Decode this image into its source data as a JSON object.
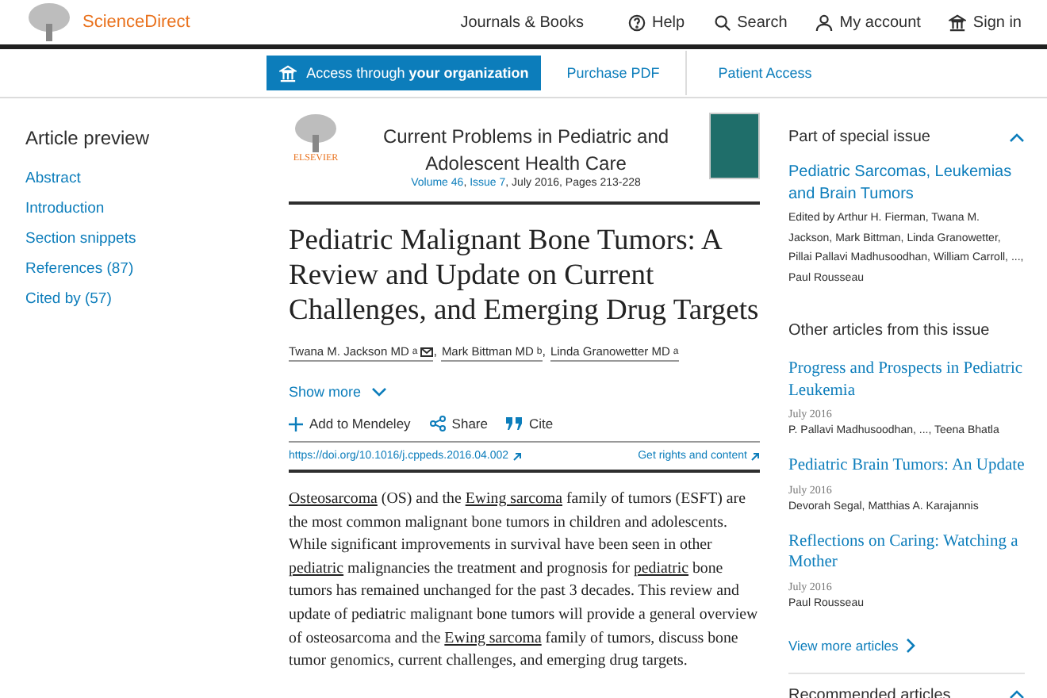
{
  "header": {
    "brand": "ScienceDirect",
    "nav": [
      {
        "label": "Journals & Books",
        "kind": "text"
      },
      {
        "label": "Help",
        "kind": "help"
      },
      {
        "label": "Search",
        "kind": "search"
      },
      {
        "label": "My account",
        "kind": "account"
      },
      {
        "label": "Sign in",
        "kind": "signin"
      }
    ]
  },
  "access_bar": {
    "access_button": {
      "prefix": "Access through ",
      "bold": "your organization"
    },
    "links": [
      "Purchase PDF",
      "Patient Access"
    ]
  },
  "sidebar": {
    "title": "Article preview",
    "items": [
      "Abstract",
      "Introduction",
      "Section snippets",
      "References (87)",
      "Cited by (57)"
    ]
  },
  "journal": {
    "publisher": "ELSEVIER",
    "name": "Current Problems in Pediatric and Adolescent Health Care",
    "volume_line": [
      {
        "text": "Volume 46",
        "link": true
      },
      {
        "text": ", ",
        "link": false
      },
      {
        "text": "Issue 7",
        "link": true
      },
      {
        "text": ", July 2016, Pages 213-228",
        "link": false
      }
    ]
  },
  "article": {
    "title": "Pediatric Malignant Bone Tumors: A Review and Update on Current Challenges, and Emerging Drug Targets",
    "authors": [
      {
        "name": "Twana M. Jackson MD",
        "sup": "a",
        "email": true,
        "separator": ","
      },
      {
        "name": "Mark Bittman MD",
        "sup": "b",
        "email": false,
        "separator": ","
      },
      {
        "name": "Linda Granowetter MD",
        "sup": "a",
        "email": false
      }
    ],
    "show_more": "Show more",
    "actions": [
      {
        "label": "Add to Mendeley",
        "kind": "add"
      },
      {
        "label": "Share",
        "kind": "share"
      },
      {
        "label": "Cite",
        "kind": "cite"
      }
    ],
    "doi": "https://doi.org/10.1016/j.cppeds.2016.04.002",
    "rights": "Get rights and content",
    "abstract": [
      {
        "text": "Osteosarcoma",
        "link": true
      },
      {
        "text": " (OS) and the ",
        "link": false
      },
      {
        "text": "Ewing sarcoma",
        "link": true
      },
      {
        "text": " family of tumors (ESFT) are the most common malignant bone tumors in children and adolescents. While significant improvements in survival have been seen in other ",
        "link": false
      },
      {
        "text": "pediatric",
        "link": true
      },
      {
        "text": " malignancies the treatment and prognosis for ",
        "link": false
      },
      {
        "text": "pediatric",
        "link": true
      },
      {
        "text": " bone tumors has remained unchanged for the past 3 decades. This review and update of pediatric malignant bone tumors will provide a general overview of osteosarcoma and the ",
        "link": false
      },
      {
        "text": "Ewing sarcoma",
        "link": true
      },
      {
        "text": " family of tumors, discuss bone tumor genomics, current challenges, and emerging drug targets.",
        "link": false
      }
    ]
  },
  "special_issue": {
    "heading": "Part of special issue",
    "expanded": true,
    "title": "Pediatric Sarcomas, Leukemias and Brain Tumors",
    "editors": "Edited by Arthur H. Fierman, Twana M. Jackson, Mark Bittman, Linda Granowetter, Pillai Pallavi Madhusoodhan, William Carroll, ..., Paul Rousseau"
  },
  "other_articles": {
    "heading": "Other articles from this issue",
    "items": [
      {
        "title": "Progress and Prospects in Pediatric Leukemia",
        "date": "July 2016",
        "authors": "P. Pallavi Madhusoodhan, ..., Teena Bhatla"
      },
      {
        "title": "Pediatric Brain Tumors: An Update",
        "date": "July 2016",
        "authors": "Devorah Segal, Matthias A. Karajannis"
      },
      {
        "title": "Reflections on Caring: Watching a Mother",
        "date": "July 2016",
        "authors": "Paul Rousseau"
      }
    ],
    "view_more": "View more articles"
  },
  "recommended": {
    "heading": "Recommended articles",
    "expanded": true
  }
}
